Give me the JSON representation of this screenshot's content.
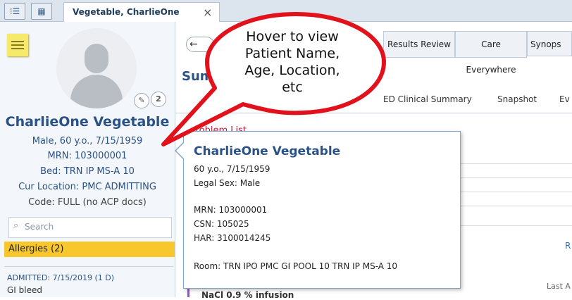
{
  "tabstrip": {
    "icons": [
      "list-person-icon",
      "chart-icon"
    ],
    "active_tab": "Vegetable, CharlieOne",
    "close": "×"
  },
  "sidebar": {
    "patient_name": "CharlieOne Vegetable",
    "sex_age_dob": "Male, 60 y.o., 7/15/1959",
    "mrn": "MRN: 103000001",
    "bed": "Bed: TRN IP MS-A 10",
    "location": "Cur Location: PMC ADMITTING",
    "code": "Code: FULL (no ACP docs)",
    "search_placeholder": "Search",
    "allergies": "Allergies (2)",
    "admitted": "ADMITTED: 7/15/2019 (1 D)",
    "diagnosis": "GI bleed",
    "notification_count": "2"
  },
  "main": {
    "back_symbol": "←",
    "activity_tabs": [
      "Results Review",
      "Care Everywhere",
      "Synops"
    ],
    "title": "Sum",
    "sub_tabs": [
      "ED Clinical Summary",
      "Snapshot",
      "Ev"
    ],
    "problem_list": "Problem List",
    "right_link": "R",
    "last_label": "Last A",
    "infusion": "NaCl 0.9 % infusion"
  },
  "hover_card": {
    "name": "CharlieOne Vegetable",
    "age_dob": "60 y.o., 7/15/1959",
    "legal_sex": "Legal Sex: Male",
    "mrn": "MRN: 103000001",
    "csn": "CSN: 105025",
    "har": "HAR: 3100014245",
    "room": "Room: TRN IPO PMC GI POOL 10 TRN IP MS-A 10"
  },
  "callout": {
    "lines": [
      "Hover to view",
      "Patient Name,",
      "Age, Location,",
      "etc"
    ]
  },
  "colors": {
    "name_blue": "#2a5286",
    "allergy_yellow": "#f8c72e",
    "callout_red": "#e1121b"
  }
}
